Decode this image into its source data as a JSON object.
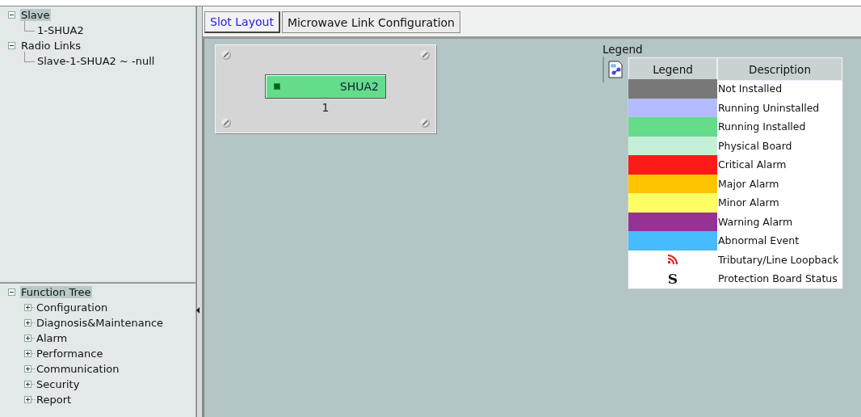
{
  "nav_tree": [
    {
      "label": "Slave",
      "selected": true,
      "expanded": true,
      "children": [
        {
          "label": "1-SHUA2",
          "selected": false
        }
      ]
    },
    {
      "label": "Radio Links",
      "selected": false,
      "expanded": true,
      "children": [
        {
          "label": "Slave-1-SHUA2 ~ -null",
          "selected": false
        }
      ]
    }
  ],
  "function_tree": {
    "label": "Function Tree",
    "selected": true,
    "expanded": true,
    "children": [
      {
        "label": "Configuration",
        "expanded": false
      },
      {
        "label": "Diagnosis&Maintenance",
        "expanded": false
      },
      {
        "label": "Alarm",
        "expanded": false
      },
      {
        "label": "Performance",
        "expanded": false
      },
      {
        "label": "Communication",
        "expanded": false
      },
      {
        "label": "Security",
        "expanded": false
      },
      {
        "label": "Report",
        "expanded": false
      }
    ]
  },
  "tabs": [
    {
      "label": "Slot Layout",
      "selected": true
    },
    {
      "label": "Microwave Link Configuration",
      "selected": false
    }
  ],
  "slot_panel": {
    "boards": [
      {
        "name": "SHUA2",
        "slot": "1",
        "color": "#64dc8c"
      }
    ]
  },
  "legend": {
    "title": "Legend",
    "columns": [
      "Legend",
      "Description"
    ],
    "rows": [
      {
        "kind": "swatch",
        "color": "#787878",
        "description": "Not Installed"
      },
      {
        "kind": "swatch",
        "color": "#b4bcff",
        "description": "Running Uninstalled"
      },
      {
        "kind": "swatch",
        "color": "#64dc8c",
        "description": "Running Installed"
      },
      {
        "kind": "swatch",
        "color": "#c3f0d7",
        "description": "Physical Board"
      },
      {
        "kind": "swatch",
        "color": "#ff1a1a",
        "description": "Critical Alarm"
      },
      {
        "kind": "swatch",
        "color": "#ffc400",
        "description": "Major Alarm"
      },
      {
        "kind": "swatch",
        "color": "#ffff64",
        "description": "Minor Alarm"
      },
      {
        "kind": "swatch",
        "color": "#963296",
        "description": "Warning Alarm"
      },
      {
        "kind": "swatch",
        "color": "#46bcff",
        "description": "Abnormal Event"
      },
      {
        "kind": "loopback",
        "description": "Tributary/Line Loopback"
      },
      {
        "kind": "symbol",
        "symbol": "S",
        "description": "Protection Board Status"
      }
    ]
  }
}
